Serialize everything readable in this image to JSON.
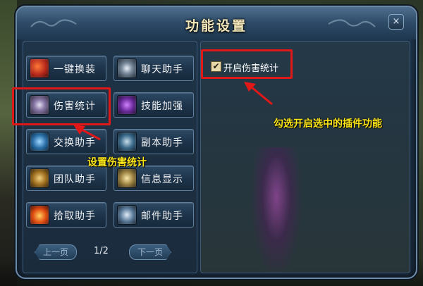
{
  "window": {
    "title": "功能设置",
    "close_label": "×"
  },
  "functions": [
    {
      "label": "一键换装",
      "icon": "armor-swap-icon"
    },
    {
      "label": "聊天助手",
      "icon": "chat-icon"
    },
    {
      "label": "伤害统计",
      "icon": "damage-stats-icon",
      "selected": true
    },
    {
      "label": "技能加强",
      "icon": "skill-icon"
    },
    {
      "label": "交换助手",
      "icon": "trade-icon"
    },
    {
      "label": "副本助手",
      "icon": "dungeon-icon"
    },
    {
      "label": "团队助手",
      "icon": "team-icon"
    },
    {
      "label": "信息显示",
      "icon": "info-icon"
    },
    {
      "label": "拾取助手",
      "icon": "loot-icon"
    },
    {
      "label": "邮件助手",
      "icon": "mail-icon"
    }
  ],
  "pager": {
    "prev_label": "上一页",
    "page": "1/2",
    "next_label": "下一页"
  },
  "settings": {
    "enable_damage_stats": {
      "label": "开启伤害统计",
      "checked": true,
      "mark": "✔"
    }
  },
  "annotations": {
    "left_note": "设置伤害统计",
    "right_note": "勾选开启选中的插件功能"
  },
  "colors": {
    "annotation_red": "#e01818",
    "annotation_yellow": "#ffe818",
    "window_bg": "#1b2f44",
    "title_gold": "#f2e6b8"
  }
}
